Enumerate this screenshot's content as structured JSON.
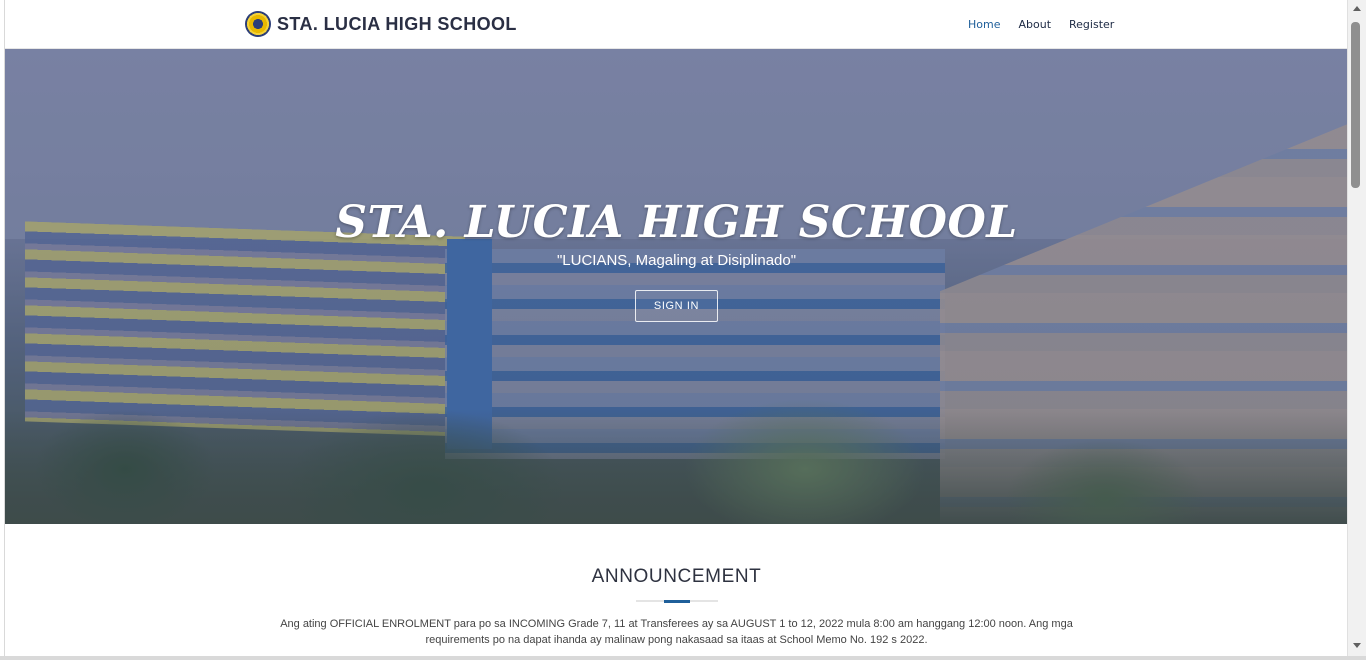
{
  "header": {
    "brand_name": "STA. LUCIA HIGH SCHOOL",
    "logo_icon": "school-seal-icon",
    "nav": [
      {
        "label": "Home",
        "active": true
      },
      {
        "label": "About",
        "active": false
      },
      {
        "label": "Register",
        "active": false
      }
    ]
  },
  "hero": {
    "title": "STA. LUCIA HIGH SCHOOL",
    "subtitle": "\"LUCIANS, Magaling at Disiplinado\"",
    "signin_label": "SIGN IN"
  },
  "announcement": {
    "title": "ANNOUNCEMENT",
    "text": "Ang ating OFFICIAL ENROLMENT para po sa INCOMING Grade 7, 11 at Transferees ay sa AUGUST 1 to 12, 2022 mula 8:00 am hanggang 12:00 noon. Ang mga requirements po na dapat ihanda ay malinaw pong nakasaad sa itaas at School Memo No. 192 s 2022."
  },
  "colors": {
    "accent": "#1f5f9a",
    "brand_text": "#2a2f44"
  }
}
